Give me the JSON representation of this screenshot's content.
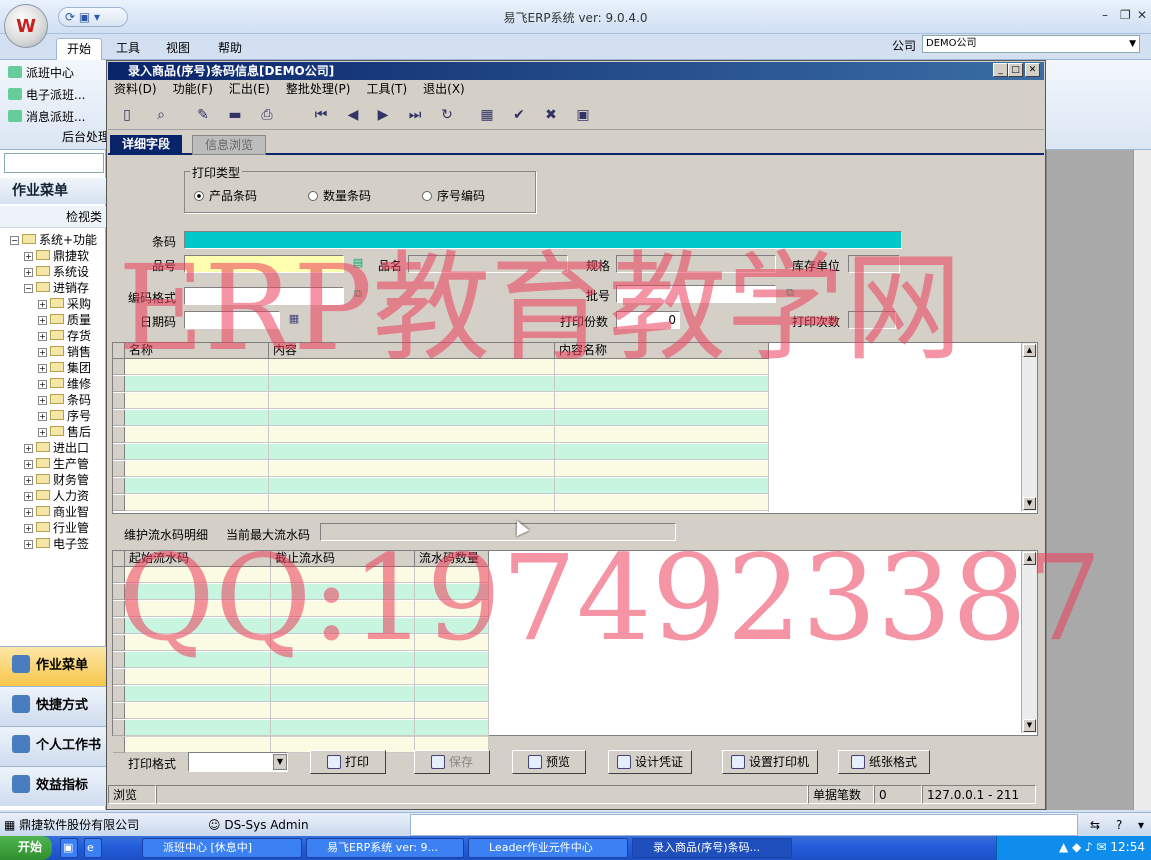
{
  "app": {
    "title": "易飞ERP系统 ver: 9.0.4.0",
    "ribbon_tabs": [
      "开始",
      "工具",
      "视图",
      "帮助"
    ],
    "company_label": "公司",
    "company_value": "DEMO公司",
    "ribbon_items": [
      "派班中心",
      "电子派班...",
      "消息派班..."
    ],
    "ribbon_group": "后台处理"
  },
  "left_panel": {
    "menu_title": "作业菜单",
    "menu_sub": "检视类",
    "tree": [
      {
        "label": "系统+功能",
        "level": 0
      },
      {
        "label": "鼎捷软",
        "level": 1
      },
      {
        "label": "系统设",
        "level": 1
      },
      {
        "label": "进销存",
        "level": 1
      },
      {
        "label": "采购",
        "level": 2
      },
      {
        "label": "质量",
        "level": 2
      },
      {
        "label": "存货",
        "level": 2
      },
      {
        "label": "销售",
        "level": 2
      },
      {
        "label": "集团",
        "level": 2
      },
      {
        "label": "维修",
        "level": 2
      },
      {
        "label": "条码",
        "level": 2
      },
      {
        "label": "序号",
        "level": 2
      },
      {
        "label": "售后",
        "level": 2
      },
      {
        "label": "进出口",
        "level": 1
      },
      {
        "label": "生产管",
        "level": 1
      },
      {
        "label": "财务管",
        "level": 1
      },
      {
        "label": "人力资",
        "level": 1
      },
      {
        "label": "商业智",
        "level": 1
      },
      {
        "label": "行业管",
        "level": 1
      },
      {
        "label": "电子签",
        "level": 1
      }
    ],
    "nav_buttons": [
      "作业菜单",
      "快捷方式",
      "个人工作书",
      "效益指标"
    ]
  },
  "child_window": {
    "title": "录入商品(序号)条码信息[DEMO公司]",
    "menu": [
      "资料(D)",
      "功能(F)",
      "汇出(E)",
      "整批处理(P)",
      "工具(T)",
      "退出(X)"
    ],
    "tabs": [
      "详细字段",
      "信息浏览"
    ],
    "print_type": {
      "title": "打印类型",
      "options": [
        "产品条码",
        "数量条码",
        "序号编码"
      ],
      "selected": 0
    },
    "fields": {
      "barcode_label": "条码",
      "item_no_label": "品号",
      "item_name_label": "品名",
      "spec_label": "规格",
      "unit_label": "库存单位",
      "code_format_label": "编码格式",
      "lot_label": "批号",
      "date_code_label": "日期码",
      "print_copies_label": "打印份数",
      "print_copies_value": "0",
      "print_times_label": "打印次数"
    },
    "grid1": {
      "columns": [
        "名称",
        "内容",
        "内容名称"
      ],
      "rows": 9
    },
    "serial": {
      "label": "维护流水码明细",
      "max_label": "当前最大流水码"
    },
    "grid2": {
      "columns": [
        "起始流水码",
        "截止流水码",
        "流水码数量"
      ],
      "rows": 11
    },
    "bottom": {
      "print_format_label": "打印格式",
      "buttons": [
        "打印",
        "保存",
        "预览",
        "设计凭证",
        "设置打印机",
        "纸张格式"
      ]
    },
    "status": {
      "mode": "浏览",
      "record_label": "单据笔数",
      "record_value": "0",
      "server": "127.0.0.1 - 211"
    }
  },
  "app_status": {
    "company": "鼎捷软件股份有限公司",
    "user": "DS-Sys Admin"
  },
  "taskbar": {
    "start": "开始",
    "tasks": [
      "派班中心 [休息中]",
      "易飞ERP系统 ver: 9...",
      "Leader作业元件中心",
      "录入商品(序号)条码..."
    ],
    "clock": "12:54"
  },
  "watermarks": [
    "ERP教育教学网",
    "QQ:1974923387"
  ]
}
